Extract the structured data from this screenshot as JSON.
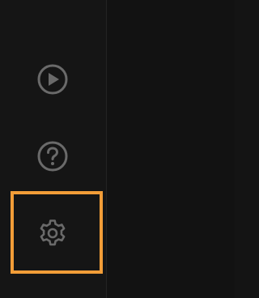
{
  "sidebar": {
    "items": [
      {
        "id": "play",
        "icon": "play-circle-icon"
      },
      {
        "id": "help",
        "icon": "question-circle-icon"
      },
      {
        "id": "settings",
        "icon": "gear-icon",
        "highlighted": true
      }
    ]
  },
  "colors": {
    "background": "#141414",
    "divider": "#232323",
    "icon": "#6a6a6a",
    "highlight": "#f29d38"
  }
}
